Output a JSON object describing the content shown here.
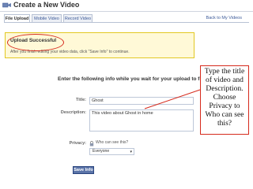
{
  "header": {
    "title": "Create a New Video"
  },
  "tabs": [
    {
      "label": "File Upload",
      "active": true
    },
    {
      "label": "Mobile Video",
      "active": false
    },
    {
      "label": "Record Video",
      "active": false
    }
  ],
  "back_link": "Back to My Videos",
  "notice": {
    "title": "Upload Successful",
    "message": "After you finish editing your video data, click \"Save Info\" to continue."
  },
  "form": {
    "heading": "Enter the following info while you wait for your upload to finish.",
    "title_label": "Title:",
    "title_value": "Ghost",
    "description_label": "Description:",
    "description_value": "This video about Ghost in home",
    "privacy_label": "Privacy:",
    "privacy_caption": "Who can see this?",
    "privacy_selected": "Everyone",
    "save_label": "Save Info"
  },
  "callout": {
    "text": "Type the title of video and Description. Choose Privacy to Who can see this?"
  },
  "icons": {
    "video": "video-camera-icon",
    "lock": "lock-icon",
    "dropdown": "chevron-down-icon"
  },
  "colors": {
    "annotation_red": "#d62a1c",
    "notice_background": "#fff9d7",
    "notice_border": "#e2c822",
    "link_blue": "#3b5998",
    "button_blue": "#5b74a8"
  }
}
